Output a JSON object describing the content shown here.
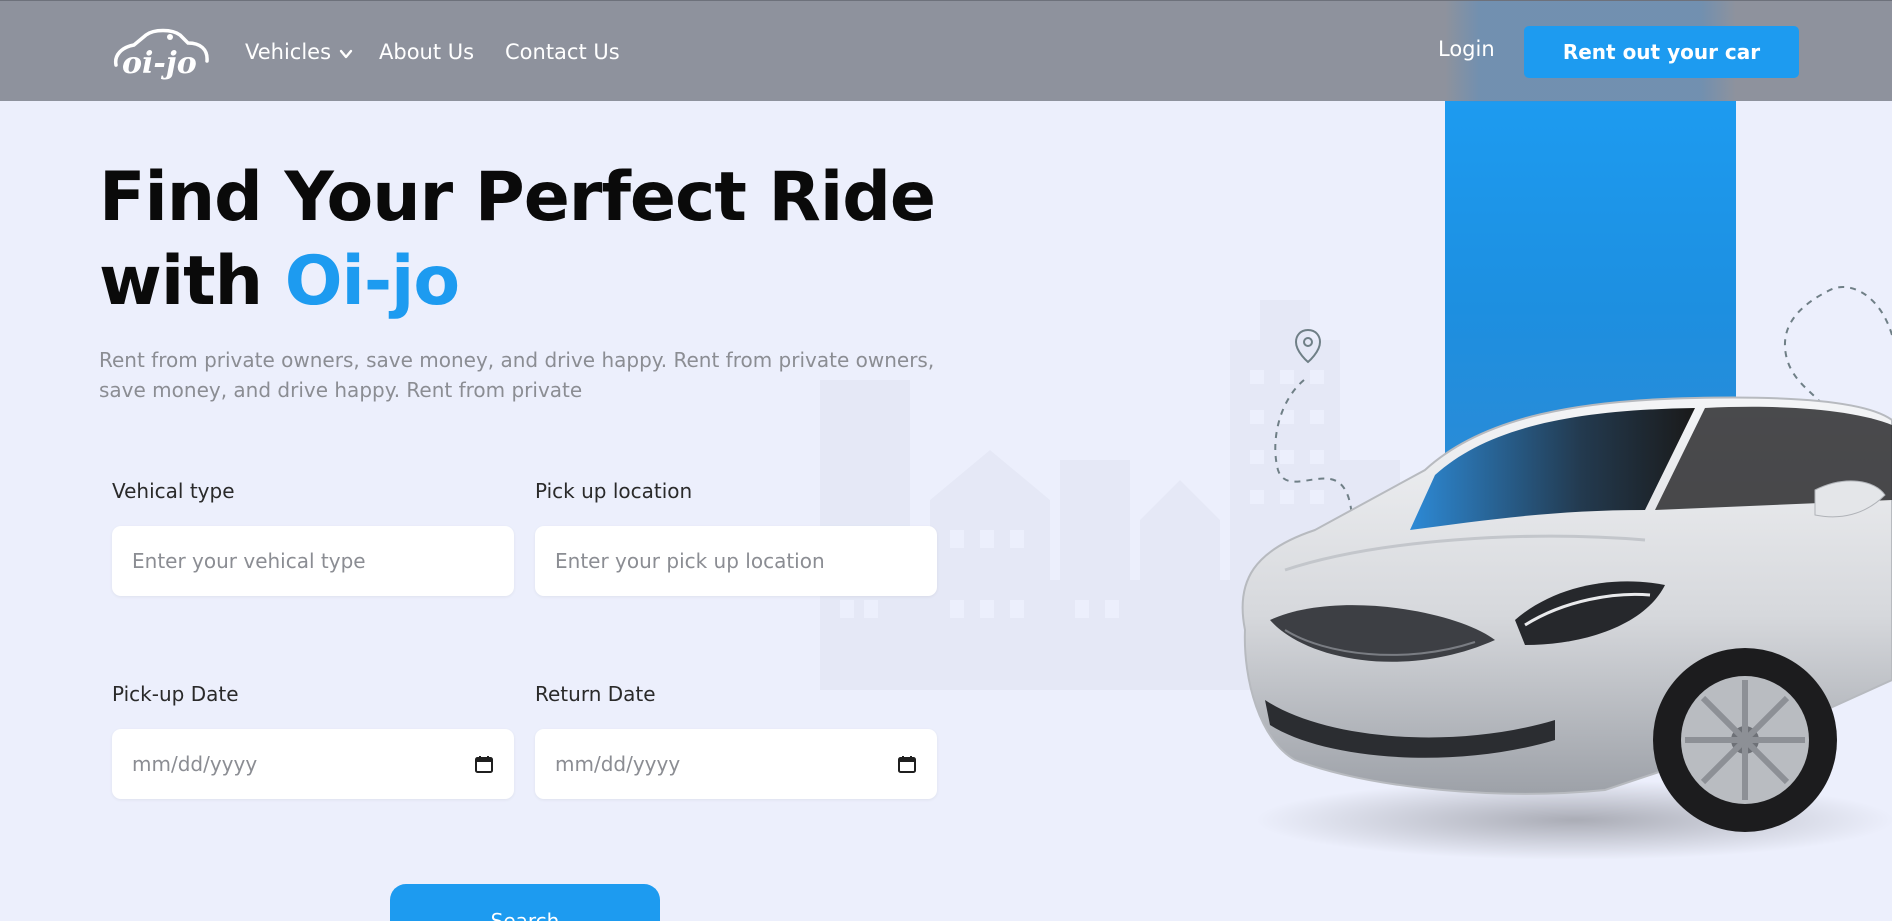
{
  "brand": {
    "logo_text": "oi-jo",
    "accent_color": "#1d9bf0",
    "header_color": "#8e929d"
  },
  "nav": {
    "vehicles": "Vehicles",
    "about": "About Us",
    "contact": "Contact Us",
    "login": "Login",
    "rent_out": "Rent out your car"
  },
  "hero": {
    "title_line1": "Find Your Perfect Ride",
    "title_line2_prefix": "with ",
    "title_brand": "Oi-jo",
    "subtitle": "Rent from private owners, save money, and drive happy. Rent from private owners, save money, and drive happy. Rent from private"
  },
  "form": {
    "vehicle_type": {
      "label": "Vehical type",
      "placeholder": "Enter your vehical type"
    },
    "pickup_location": {
      "label": "Pick up location",
      "placeholder": "Enter your pick up location"
    },
    "pickup_date": {
      "label": "Pick-up Date",
      "placeholder": "mm/dd/yyyy"
    },
    "return_date": {
      "label": "Return Date",
      "placeholder": "mm/dd/yyyy"
    },
    "search_label": "Search"
  },
  "icons": [
    "chevron-down-icon",
    "calendar-icon",
    "location-pin-icon"
  ]
}
